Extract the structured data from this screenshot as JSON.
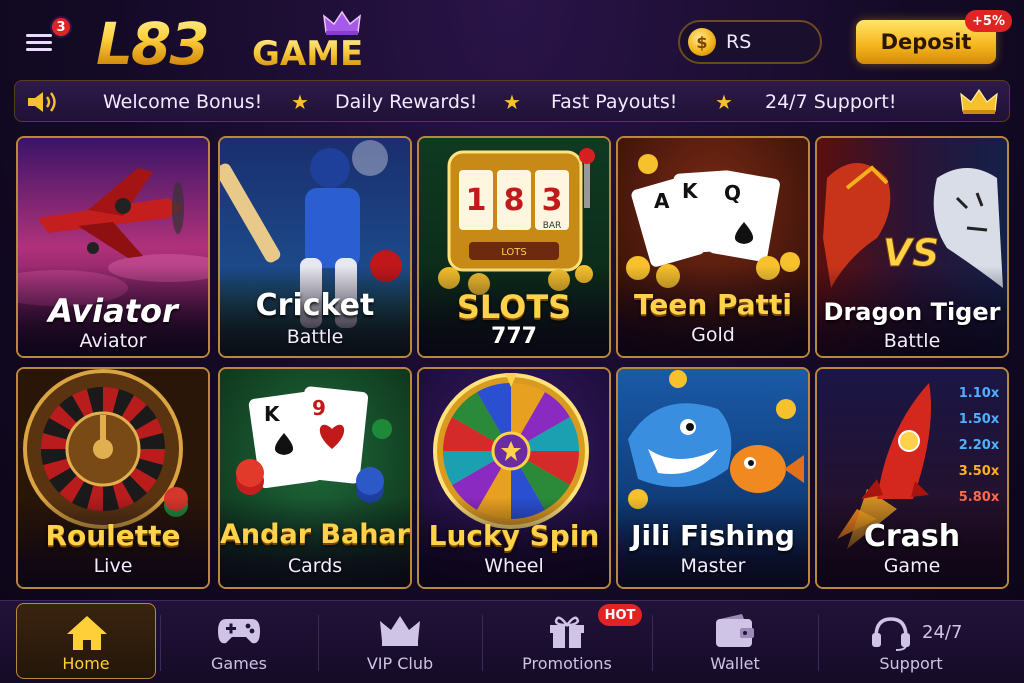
{
  "header": {
    "menu_badge_count": "3",
    "logo_main": "L83",
    "logo_sub": "GAME",
    "currency_symbol": "$",
    "balance_label": "RS",
    "deposit_label": "Deposit",
    "deposit_bonus": "+5%"
  },
  "ticker": {
    "items": [
      "Welcome Bonus!",
      "Daily Rewards!",
      "Fast Payouts!",
      "24/7 Support!"
    ],
    "separator": "★"
  },
  "games": [
    {
      "title": "Aviator",
      "subtitle": "Aviator"
    },
    {
      "title": "Cricket",
      "subtitle": "Battle"
    },
    {
      "title": "SLOTS",
      "subtitle": "777",
      "art_text": [
        "1",
        "8",
        "3",
        "LOTS",
        "BAR"
      ]
    },
    {
      "title": "Teen Patti",
      "subtitle": "Gold",
      "art_text": [
        "A",
        "K",
        "Q"
      ]
    },
    {
      "title": "Dragon Tiger",
      "subtitle": "Battle",
      "art_text": "VS"
    },
    {
      "title": "Roulette",
      "subtitle": "Live"
    },
    {
      "title": "Andar Bahar",
      "subtitle": "Cards",
      "art_text": [
        "K",
        "9"
      ]
    },
    {
      "title": "Lucky Spin",
      "subtitle": "Wheel"
    },
    {
      "title": "Jili Fishing",
      "subtitle": "Master"
    },
    {
      "title": "Crash",
      "subtitle": "Game",
      "multipliers": [
        "1.10x",
        "1.50x",
        "2.20x",
        "3.50x",
        "5.80x"
      ]
    }
  ],
  "nav": {
    "items": [
      {
        "label": "Home",
        "icon": "home-icon"
      },
      {
        "label": "Games",
        "icon": "gamepad-icon"
      },
      {
        "label": "VIP Club",
        "icon": "crown-icon"
      },
      {
        "label": "Promotions",
        "icon": "gift-icon"
      },
      {
        "label": "Wallet",
        "icon": "wallet-icon"
      },
      {
        "label": "Support",
        "icon": "headset-icon"
      }
    ],
    "hot_badge": "HOT",
    "support_hours": "24/7"
  },
  "colors": {
    "accent_gold": "#f7b820",
    "badge_red": "#e02424",
    "background": "#140a26",
    "card_border": "#b9883a"
  }
}
